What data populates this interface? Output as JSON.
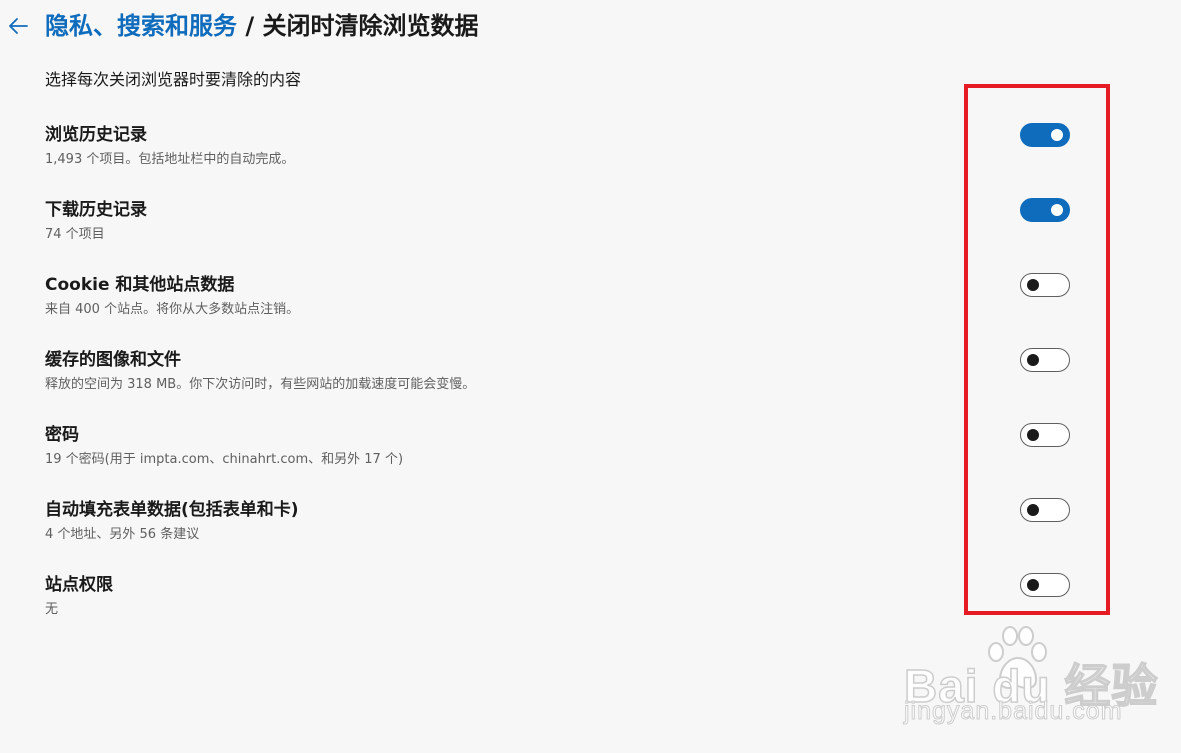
{
  "header": {
    "breadcrumb_parent": "隐私、搜索和服务",
    "breadcrumb_separator": " / ",
    "title": "关闭时清除浏览数据"
  },
  "intro": "选择每次关闭浏览器时要清除的内容",
  "items": [
    {
      "title": "浏览历史记录",
      "description": "1,493 个项目。包括地址栏中的自动完成。",
      "enabled": true
    },
    {
      "title": "下载历史记录",
      "description": "74 个项目",
      "enabled": true
    },
    {
      "title": "Cookie 和其他站点数据",
      "description": "来自 400 个站点。将你从大多数站点注销。",
      "enabled": false
    },
    {
      "title": "缓存的图像和文件",
      "description": "释放的空间为 318 MB。你下次访问时，有些网站的加载速度可能会变慢。",
      "enabled": false
    },
    {
      "title": "密码",
      "description": "19 个密码(用于 impta.com、chinahrt.com、和另外 17 个)",
      "enabled": false
    },
    {
      "title": "自动填充表单数据(包括表单和卡)",
      "description": "4 个地址、另外 56 条建议",
      "enabled": false
    },
    {
      "title": "站点权限",
      "description": "无",
      "enabled": false
    }
  ],
  "watermark": {
    "brand": "Bai du 经验",
    "domain": "jingyan.baidu.com"
  },
  "colors": {
    "accent": "#0f6cbd",
    "highlight": "#e61c24",
    "background": "#f7f7f7"
  },
  "icons": {
    "back": "back-arrow-icon",
    "watermark_logo": "paw-icon"
  }
}
